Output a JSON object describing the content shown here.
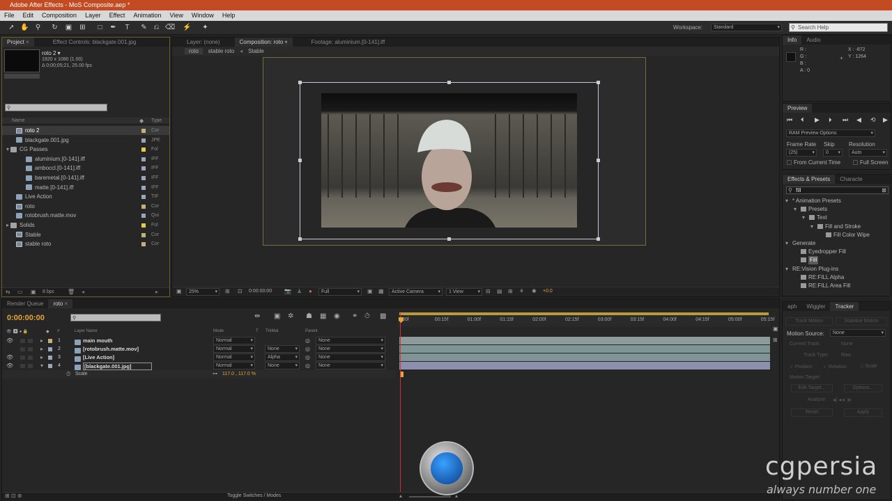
{
  "title": "Adobe After Effects - MoS Composite.aep *",
  "menu": [
    "File",
    "Edit",
    "Composition",
    "Layer",
    "Effect",
    "Animation",
    "View",
    "Window",
    "Help"
  ],
  "workspace": {
    "label": "Workspace:",
    "value": "Standard"
  },
  "search_help": "Search Help",
  "project": {
    "tabs": [
      "Project",
      "Effect Controls: blackgate.001.jpg"
    ],
    "comp_name": "roto 2 ▾",
    "comp_info1": "1920 x 1080 (1.00)",
    "comp_info2": "Δ 0;00;05;21, 25.00 fps",
    "col_name": "Name",
    "col_type": "Type",
    "bpc": "8 bpc",
    "items": [
      {
        "name": "roto 2",
        "type": "Cor",
        "color": "#c6b07a",
        "kind": "comp",
        "indent": 0,
        "selected": true
      },
      {
        "name": "blackgate.001.jpg",
        "type": "JPE",
        "color": "#9aa6bb",
        "kind": "file",
        "indent": 0
      },
      {
        "name": "CG Passes",
        "type": "Fol",
        "color": "#e4cc44",
        "kind": "folder",
        "indent": 0,
        "twirl": "▾"
      },
      {
        "name": "aluminium.[0-141].iff",
        "type": "IFF",
        "color": "#9aa6bb",
        "kind": "file",
        "indent": 1
      },
      {
        "name": "amboccl.[0-141].iff",
        "type": "IFF",
        "color": "#9aa6bb",
        "kind": "file",
        "indent": 1
      },
      {
        "name": "baremetal.[0-141].iff",
        "type": "IFF",
        "color": "#9aa6bb",
        "kind": "file",
        "indent": 1
      },
      {
        "name": "matte.[0-141].iff",
        "type": "IFF",
        "color": "#9aa6bb",
        "kind": "file",
        "indent": 1
      },
      {
        "name": "Live Action",
        "type": "TIF",
        "color": "#9aa6bb",
        "kind": "file",
        "indent": 0
      },
      {
        "name": "roto",
        "type": "Cor",
        "color": "#c6b07a",
        "kind": "comp",
        "indent": 0
      },
      {
        "name": "rotobrush.matte.mov",
        "type": "Qui",
        "color": "#9aa6bb",
        "kind": "file",
        "indent": 0
      },
      {
        "name": "Solids",
        "type": "Fol",
        "color": "#e4cc44",
        "kind": "folder",
        "indent": 0,
        "twirl": "▸"
      },
      {
        "name": "Stable",
        "type": "Cor",
        "color": "#c6b07a",
        "kind": "comp",
        "indent": 0
      },
      {
        "name": "stable roto",
        "type": "Cor",
        "color": "#c6b07a",
        "kind": "comp",
        "indent": 0
      }
    ]
  },
  "viewer": {
    "layer_tab": "Layer: (none)",
    "comp_tab": "Composition: roto",
    "footage_tab": "Footage: aluminium.[0-141].iff",
    "breadcrumbs": [
      "roto",
      "stable roto",
      "Stable"
    ],
    "zoom": "25%",
    "timecode": "0:00:00:00",
    "resolution": "Full",
    "camera": "Active Camera",
    "views": "1 View",
    "exposure": "+0.0"
  },
  "info": {
    "tabs": [
      "Info",
      "Audio"
    ],
    "r": "R :",
    "g": "G :",
    "b": "B :",
    "a": "A : 0",
    "x": "X : -872",
    "y": "Y : 1264"
  },
  "preview": {
    "tab": "Preview",
    "ram": "RAM Preview Options",
    "frame_rate_label": "Frame Rate",
    "skip_label": "Skip",
    "resolution_label": "Resolution",
    "frame_rate": "(25)",
    "skip": "0",
    "resolution": "Auto",
    "from_current": "From Current Time",
    "full_screen": "Full Screen"
  },
  "effects": {
    "tabs": [
      "Effects & Presets",
      "Characte"
    ],
    "search": "fill",
    "tree": [
      {
        "label": "* Animation Presets",
        "indent": 0,
        "twirl": "▾",
        "icon": false
      },
      {
        "label": "Presets",
        "indent": 1,
        "twirl": "▾",
        "icon": true
      },
      {
        "label": "Text",
        "indent": 2,
        "twirl": "▾",
        "icon": true
      },
      {
        "label": "Fill and Stroke",
        "indent": 3,
        "twirl": "▾",
        "icon": true
      },
      {
        "label": "Fill Color Wipe",
        "indent": 4,
        "twirl": "",
        "icon": true
      },
      {
        "label": "Generate",
        "indent": 0,
        "twirl": "▾",
        "icon": false
      },
      {
        "label": "Eyedropper Fill",
        "indent": 1,
        "twirl": "",
        "icon": true
      },
      {
        "label": "Fill",
        "indent": 1,
        "twirl": "",
        "icon": true,
        "selected": true
      },
      {
        "label": "RE:Vision Plug-ins",
        "indent": 0,
        "twirl": "▾",
        "icon": false
      },
      {
        "label": "RE:FILL Alpha",
        "indent": 1,
        "twirl": "",
        "icon": true
      },
      {
        "label": "RE:FILL Area Fill",
        "indent": 1,
        "twirl": "",
        "icon": true
      }
    ]
  },
  "timeline": {
    "tabs": [
      "Render Queue",
      "roto"
    ],
    "timecode": "0:00:00:00",
    "col_layer": "Layer Name",
    "col_mode": "Mode",
    "col_t": "T",
    "col_trkmat": "TrkMat",
    "col_parent": "Parent",
    "ruler": [
      "00f",
      "00:15f",
      "01:00f",
      "01:15f",
      "02:00f",
      "02:15f",
      "03:00f",
      "03:15f",
      "04:00f",
      "04:15f",
      "05:00f",
      "05:15f"
    ],
    "layers": [
      {
        "num": "1",
        "name": "main mouth",
        "mode": "Normal",
        "trkmat": "",
        "parent": "None",
        "color": "#c6b07a",
        "bar": "#8d9a9a"
      },
      {
        "num": "2",
        "name": "[rotobrush.matte.mov]",
        "mode": "Normal",
        "trkmat": "None",
        "parent": "None",
        "color": "#9aa6bb",
        "bar": "#7f9495"
      },
      {
        "num": "3",
        "name": "[Live Action]",
        "mode": "Normal",
        "trkmat": "Alpha",
        "parent": "None",
        "color": "#9aa6bb",
        "bar": "#7f9495"
      },
      {
        "num": "4",
        "name": "[blackgate.001.jpg]",
        "mode": "Normal",
        "trkmat": "None",
        "parent": "None",
        "color": "#9aa6bb",
        "bar": "#8d8faf"
      }
    ],
    "prop_name": "Scale",
    "prop_value": "117.0 , 117.0 %",
    "toggle": "Toggle Switches / Modes"
  },
  "tracker": {
    "tabs": [
      "aph",
      "Wiggler",
      "Tracker"
    ],
    "track_motion": "Track Motion",
    "stabilize": "Stabilize Motion",
    "motion_source_label": "Motion Source:",
    "motion_source": "None",
    "current_track_label": "Current Track:",
    "current_track": "None",
    "track_type_label": "Track Type:",
    "track_type": "Raw",
    "position": "Position",
    "rotation": "Rotation",
    "scale": "Scale",
    "motion_target": "Motion Target:",
    "edit_target": "Edit Target...",
    "options": "Options...",
    "analyze": "Analyze:",
    "reset": "Reset",
    "apply": "Apply"
  },
  "watermark": {
    "brand": "cgpersia",
    "tagline": "always number one"
  }
}
